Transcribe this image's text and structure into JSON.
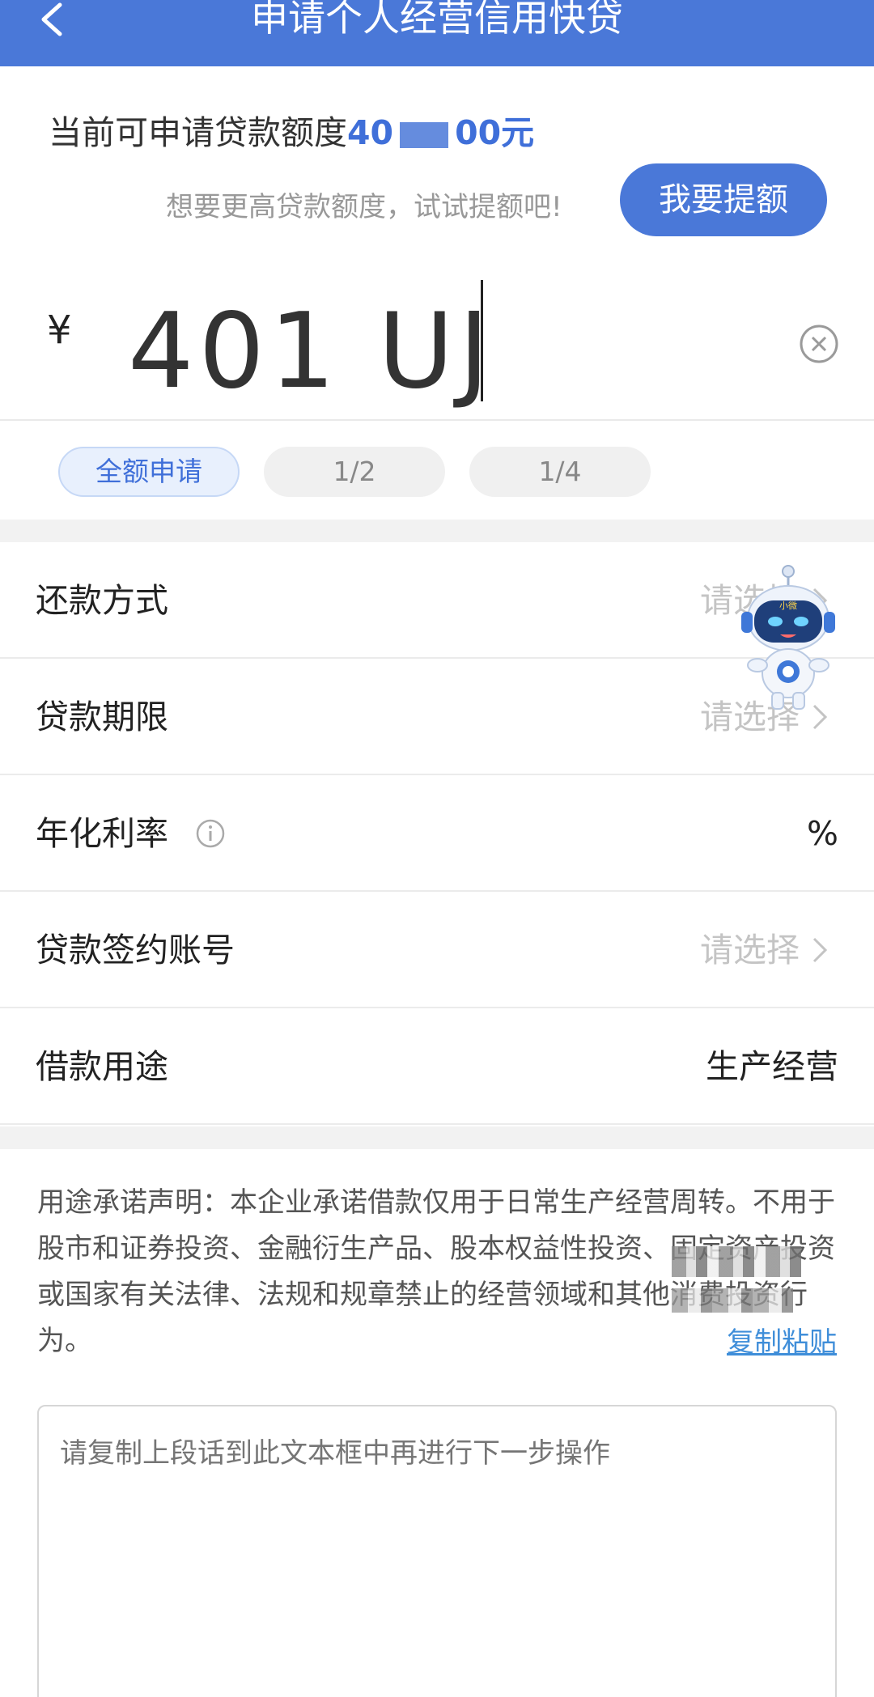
{
  "header": {
    "title": "申请个人经营信用快贷"
  },
  "quota": {
    "label": "当前可申请贷款额度",
    "amount_start": "40",
    "amount_end": "00元"
  },
  "raise": {
    "hint": "想要更高贷款额度，试试提额吧!",
    "button_label": "我要提额"
  },
  "amount": {
    "currency": "¥",
    "value": "401 UJ"
  },
  "chips": [
    "全额申请",
    "1/2",
    "1/4"
  ],
  "form": {
    "repayment": {
      "label": "还款方式",
      "value": "请选择"
    },
    "term": {
      "label": "贷款期限",
      "value": "请选择"
    },
    "rate": {
      "label": "年化利率",
      "value": "%"
    },
    "account": {
      "label": "贷款签约账号",
      "value": "请选择"
    },
    "purpose": {
      "label": "借款用途",
      "value": "生产经营"
    }
  },
  "statement": {
    "text": "用途承诺声明：本企业承诺借款仅用于日常生产经营周转。不用于股市和证券投资、金融衍生产品、股本权益性投资、固定资产投资或国家有关法律、法规和规章禁止的经营领域和其他消费投资行为。",
    "copy_link": "复制粘贴"
  },
  "textarea": {
    "placeholder": "请复制上段话到此文本框中再进行下一步操作"
  },
  "colors": {
    "brand": "#4a78d8",
    "link": "#3f8ed9",
    "placeholder": "#c4c4c4"
  },
  "mascot": {
    "label": "小微"
  }
}
